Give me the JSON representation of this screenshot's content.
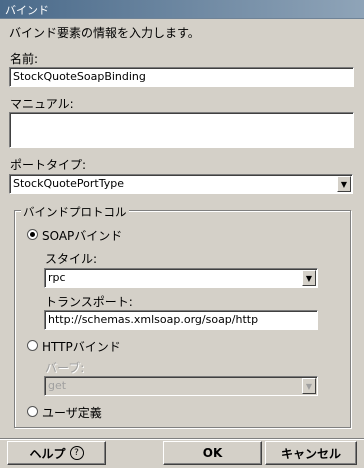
{
  "window": {
    "title": "バインド"
  },
  "instruction": "バインド要素の情報を入力します。",
  "name": {
    "label": "名前:",
    "value": "StockQuoteSoapBinding"
  },
  "manual": {
    "label": "マニュアル:",
    "value": ""
  },
  "port_type": {
    "label": "ポートタイプ:",
    "value": "StockQuotePortType"
  },
  "protocol_group": {
    "label": "バインドプロトコル",
    "soap": {
      "label": "SOAPバインド",
      "selected": true,
      "style_label": "スタイル:",
      "style_value": "rpc",
      "transport_label": "トランスポート:",
      "transport_value": "http://schemas.xmlsoap.org/soap/http"
    },
    "http": {
      "label": "HTTPバインド",
      "selected": false,
      "verb_label": "バーブ:",
      "verb_value": "get"
    },
    "user_defined": {
      "label": "ユーザ定義",
      "selected": false
    }
  },
  "buttons": {
    "help": "ヘルプ",
    "help_icon": "?",
    "ok": "OK",
    "cancel": "キャンセル"
  }
}
